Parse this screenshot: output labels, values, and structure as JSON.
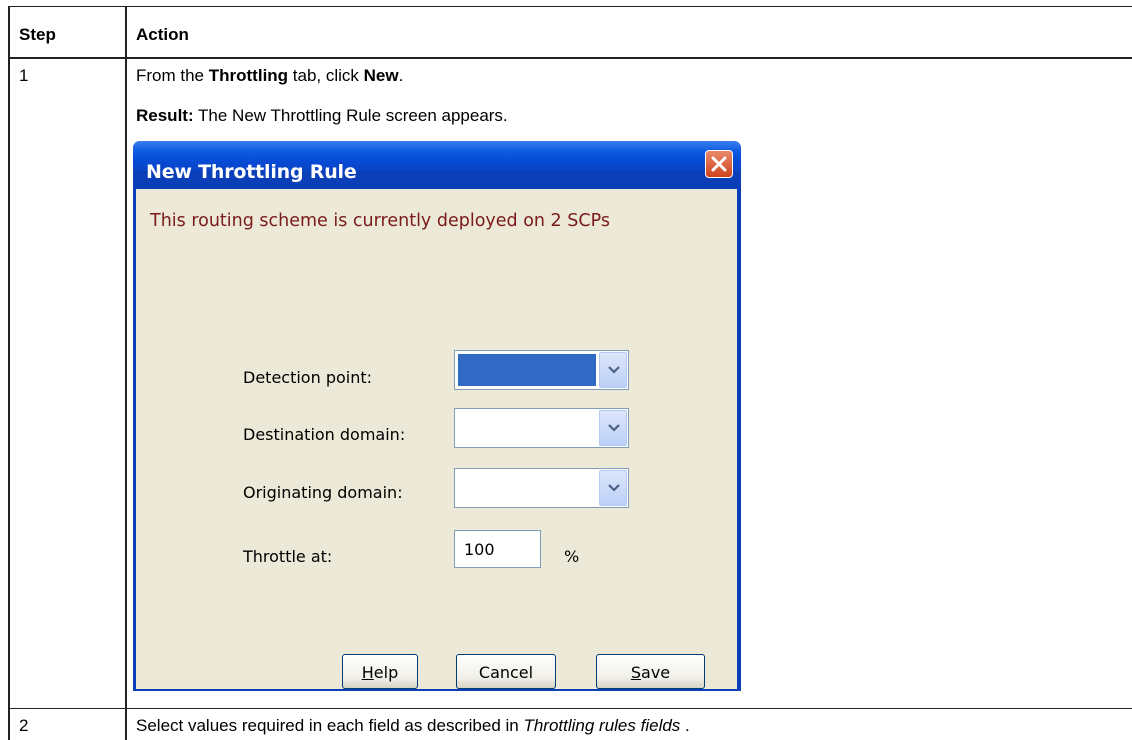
{
  "table": {
    "headers": [
      "Step",
      "Action"
    ],
    "rows": [
      {
        "step": "1",
        "line1": {
          "pre": "From the ",
          "b1": "Throttling",
          "mid": " tab, click ",
          "b2": "New",
          "post": "."
        },
        "line2": {
          "b": "Result:",
          "rest": " The New Throttling Rule screen appears."
        }
      },
      {
        "step": "2",
        "text": {
          "pre": "Select values required in each field as described in ",
          "i": "Throttling rules fields",
          "post": " ."
        }
      }
    ]
  },
  "dialog": {
    "title": "New Throttling Rule",
    "close_icon": "close-x-icon",
    "warning": "This routing scheme is currently deployed on 2 SCPs",
    "fields": {
      "detection_point": {
        "label": "Detection point:",
        "value": ""
      },
      "destination_domain": {
        "label": "Destination domain:",
        "value": ""
      },
      "originating_domain": {
        "label": "Originating domain:",
        "value": ""
      },
      "throttle_at": {
        "label": "Throttle at:",
        "value": "100",
        "unit": "%"
      }
    },
    "buttons": {
      "help": "Help",
      "cancel": "Cancel",
      "save": "Save"
    },
    "colors": {
      "title_bar": "#0a50d6",
      "close_button": "#d9522c",
      "client_bg": "#ece9d8",
      "warning_text": "#7a1a1a",
      "selection": "#316ac5"
    }
  }
}
